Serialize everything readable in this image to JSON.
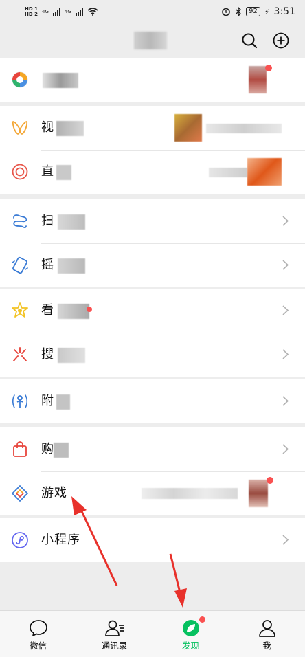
{
  "status_bar": {
    "left_indicators": [
      "HD 1",
      "HD 2",
      "4G",
      "4G"
    ],
    "battery": "92",
    "time": "3:51",
    "icons": [
      "alarm-icon",
      "bluetooth-icon",
      "battery-icon",
      "wifi-icon"
    ]
  },
  "header": {
    "icons": [
      "search-icon",
      "add-icon"
    ]
  },
  "menu": {
    "moments_label": "",
    "channels_label": "视",
    "live_label": "直",
    "scan_label": "扫",
    "shake_label": "摇",
    "top_stories_label": "看",
    "search_label": "搜",
    "nearby_label": "附",
    "shopping_label": "购",
    "games_label": "游戏",
    "mini_programs_label": "小程序",
    "icons": [
      "moments-icon",
      "channels-icon",
      "live-icon",
      "scan-icon",
      "shake-icon",
      "top-stories-icon",
      "search-feature-icon",
      "nearby-icon",
      "shopping-icon",
      "games-icon",
      "mini-programs-icon",
      "chevron-right-icon"
    ]
  },
  "tabs": [
    {
      "label": "微信",
      "icon": "chat-icon"
    },
    {
      "label": "通讯录",
      "icon": "contacts-icon"
    },
    {
      "label": "发现",
      "icon": "discover-icon",
      "active": true
    },
    {
      "label": "我",
      "icon": "me-icon"
    }
  ],
  "colors": {
    "accent_green": "#07c160",
    "badge_red": "#fa5151",
    "arrow_red": "#e8312b",
    "background": "#ededed"
  }
}
